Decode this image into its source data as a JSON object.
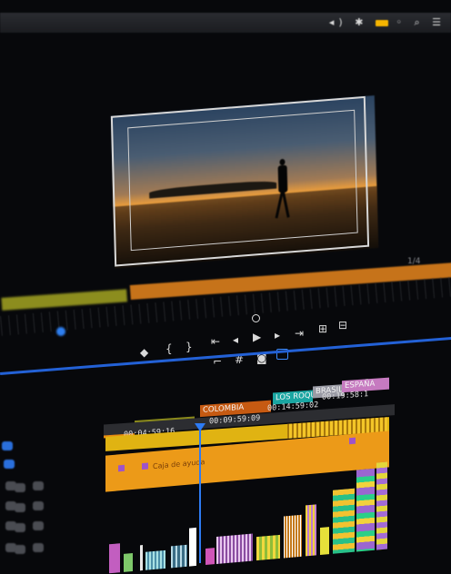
{
  "menubar": {
    "items": [
      "",
      "",
      "",
      ""
    ],
    "status_icons": "◂) ✱  ◦ ⌕ ☰"
  },
  "panel": {
    "title": "",
    "subtitle": ""
  },
  "monitor": {
    "zoom": "1/4"
  },
  "source_strip": {
    "clip_label": ""
  },
  "timeline": {
    "sequence_label": "",
    "markers": [
      {
        "label": "",
        "color": "#e98a0f"
      },
      {
        "label": "",
        "color": "#8b8a1c"
      },
      {
        "label": "COLOMBIA",
        "color": "#c65a12"
      },
      {
        "label": "LOS ROQUE",
        "color": "#1aa6a2"
      },
      {
        "label": "BRASIL",
        "color": "#9a9ba5"
      },
      {
        "label": "ESPAÑA",
        "color": "#c67ac0"
      }
    ],
    "timecodes": [
      "00:04:59:16",
      "00:09:59:09",
      "00:14:59:02",
      "00:19:58:1"
    ],
    "video_track_label": "",
    "caption_label": "Caja de ayuda"
  },
  "accent_colors": {
    "playhead": "#2d7bf3",
    "video_track": "#e0b312",
    "caption_track": "#ec9a18"
  }
}
